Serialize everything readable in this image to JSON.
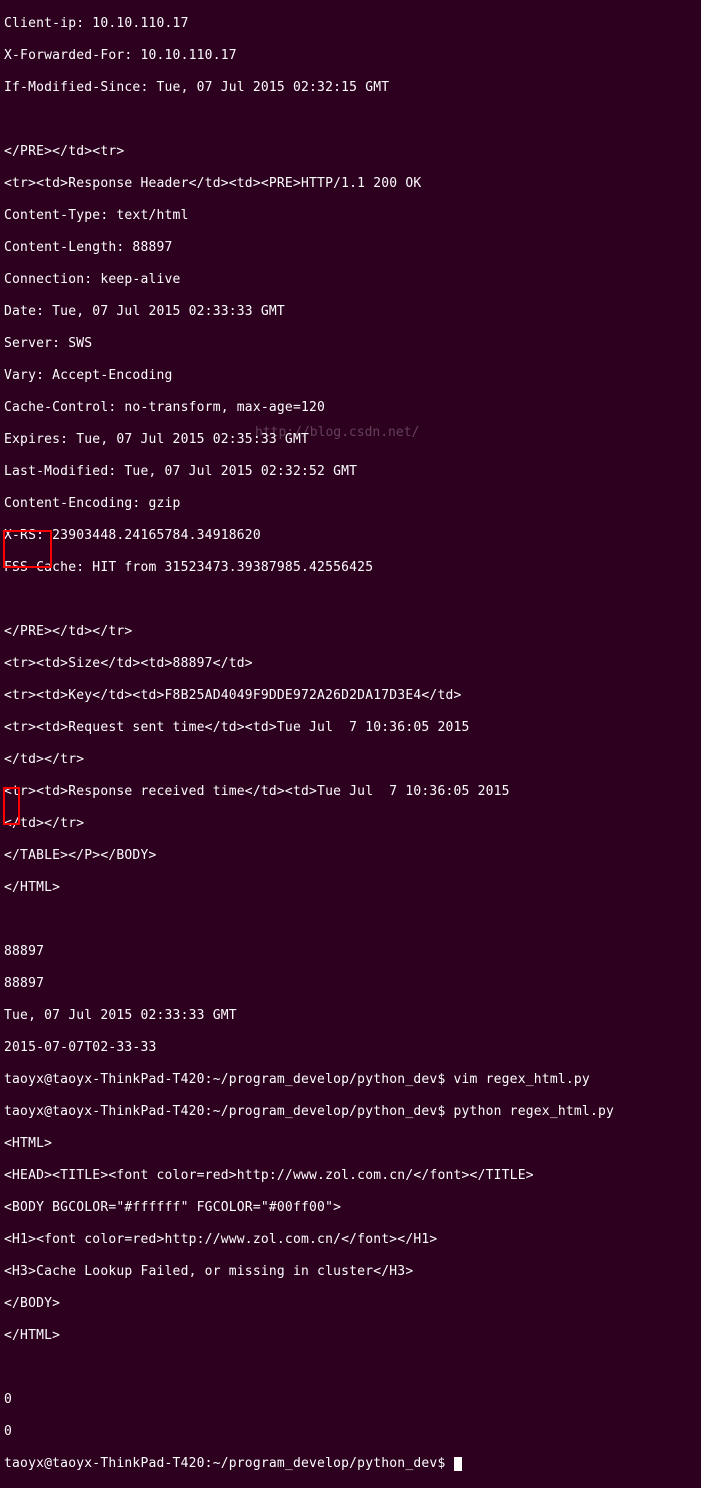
{
  "lines": {
    "l0": "Client-ip: 10.10.110.17",
    "l1": "X-Forwarded-For: 10.10.110.17",
    "l2": "If-Modified-Since: Tue, 07 Jul 2015 02:32:15 GMT",
    "l3": "",
    "l4": "</PRE></td><tr>",
    "l5": "<tr><td>Response Header</td><td><PRE>HTTP/1.1 200 OK",
    "l6": "Content-Type: text/html",
    "l7": "Content-Length: 88897",
    "l8": "Connection: keep-alive",
    "l9": "Date: Tue, 07 Jul 2015 02:33:33 GMT",
    "l10": "Server: SWS",
    "l11": "Vary: Accept-Encoding",
    "l12": "Cache-Control: no-transform, max-age=120",
    "l13": "Expires: Tue, 07 Jul 2015 02:35:33 GMT",
    "l14": "Last-Modified: Tue, 07 Jul 2015 02:32:52 GMT",
    "l15": "Content-Encoding: gzip",
    "l16": "X-RS: 23903448.24165784.34918620",
    "l17": "FSS-Cache: HIT from 31523473.39387985.42556425",
    "l18": "",
    "l19": "</PRE></td></tr>",
    "l20": "<tr><td>Size</td><td>88897</td>",
    "l21": "<tr><td>Key</td><td>F8B25AD4049F9DDE972A26D2DA17D3E4</td>",
    "l22": "<tr><td>Request sent time</td><td>Tue Jul  7 10:36:05 2015",
    "l23": "</td></tr>",
    "l24": "<tr><td>Response received time</td><td>Tue Jul  7 10:36:05 2015",
    "l25": "</td></tr>",
    "l26": "</TABLE></P></BODY>",
    "l27": "</HTML>",
    "l28": "",
    "l29": "88897",
    "l30": "88897",
    "l31": "Tue, 07 Jul 2015 02:33:33 GMT",
    "l32": "2015-07-07T02-33-33",
    "l33": "taoyx@taoyx-ThinkPad-T420:~/program_develop/python_dev$ vim regex_html.py",
    "l34": "taoyx@taoyx-ThinkPad-T420:~/program_develop/python_dev$ python regex_html.py",
    "l35": "<HTML>",
    "l36": "<HEAD><TITLE><font color=red>http://www.zol.com.cn/</font></TITLE>",
    "l37": "<BODY BGCOLOR=\"#ffffff\" FGCOLOR=\"#00ff00\">",
    "l38": "<H1><font color=red>http://www.zol.com.cn/</font></H1>",
    "l39": "<H3>Cache Lookup Failed, or missing in cluster</H3>",
    "l40": "</BODY>",
    "l41": "</HTML>",
    "l42": "",
    "l43": "0",
    "l44": "0",
    "l45": "taoyx@taoyx-ThinkPad-T420:~/program_develop/python_dev$ "
  },
  "watermark": "http://blog.csdn.net/"
}
